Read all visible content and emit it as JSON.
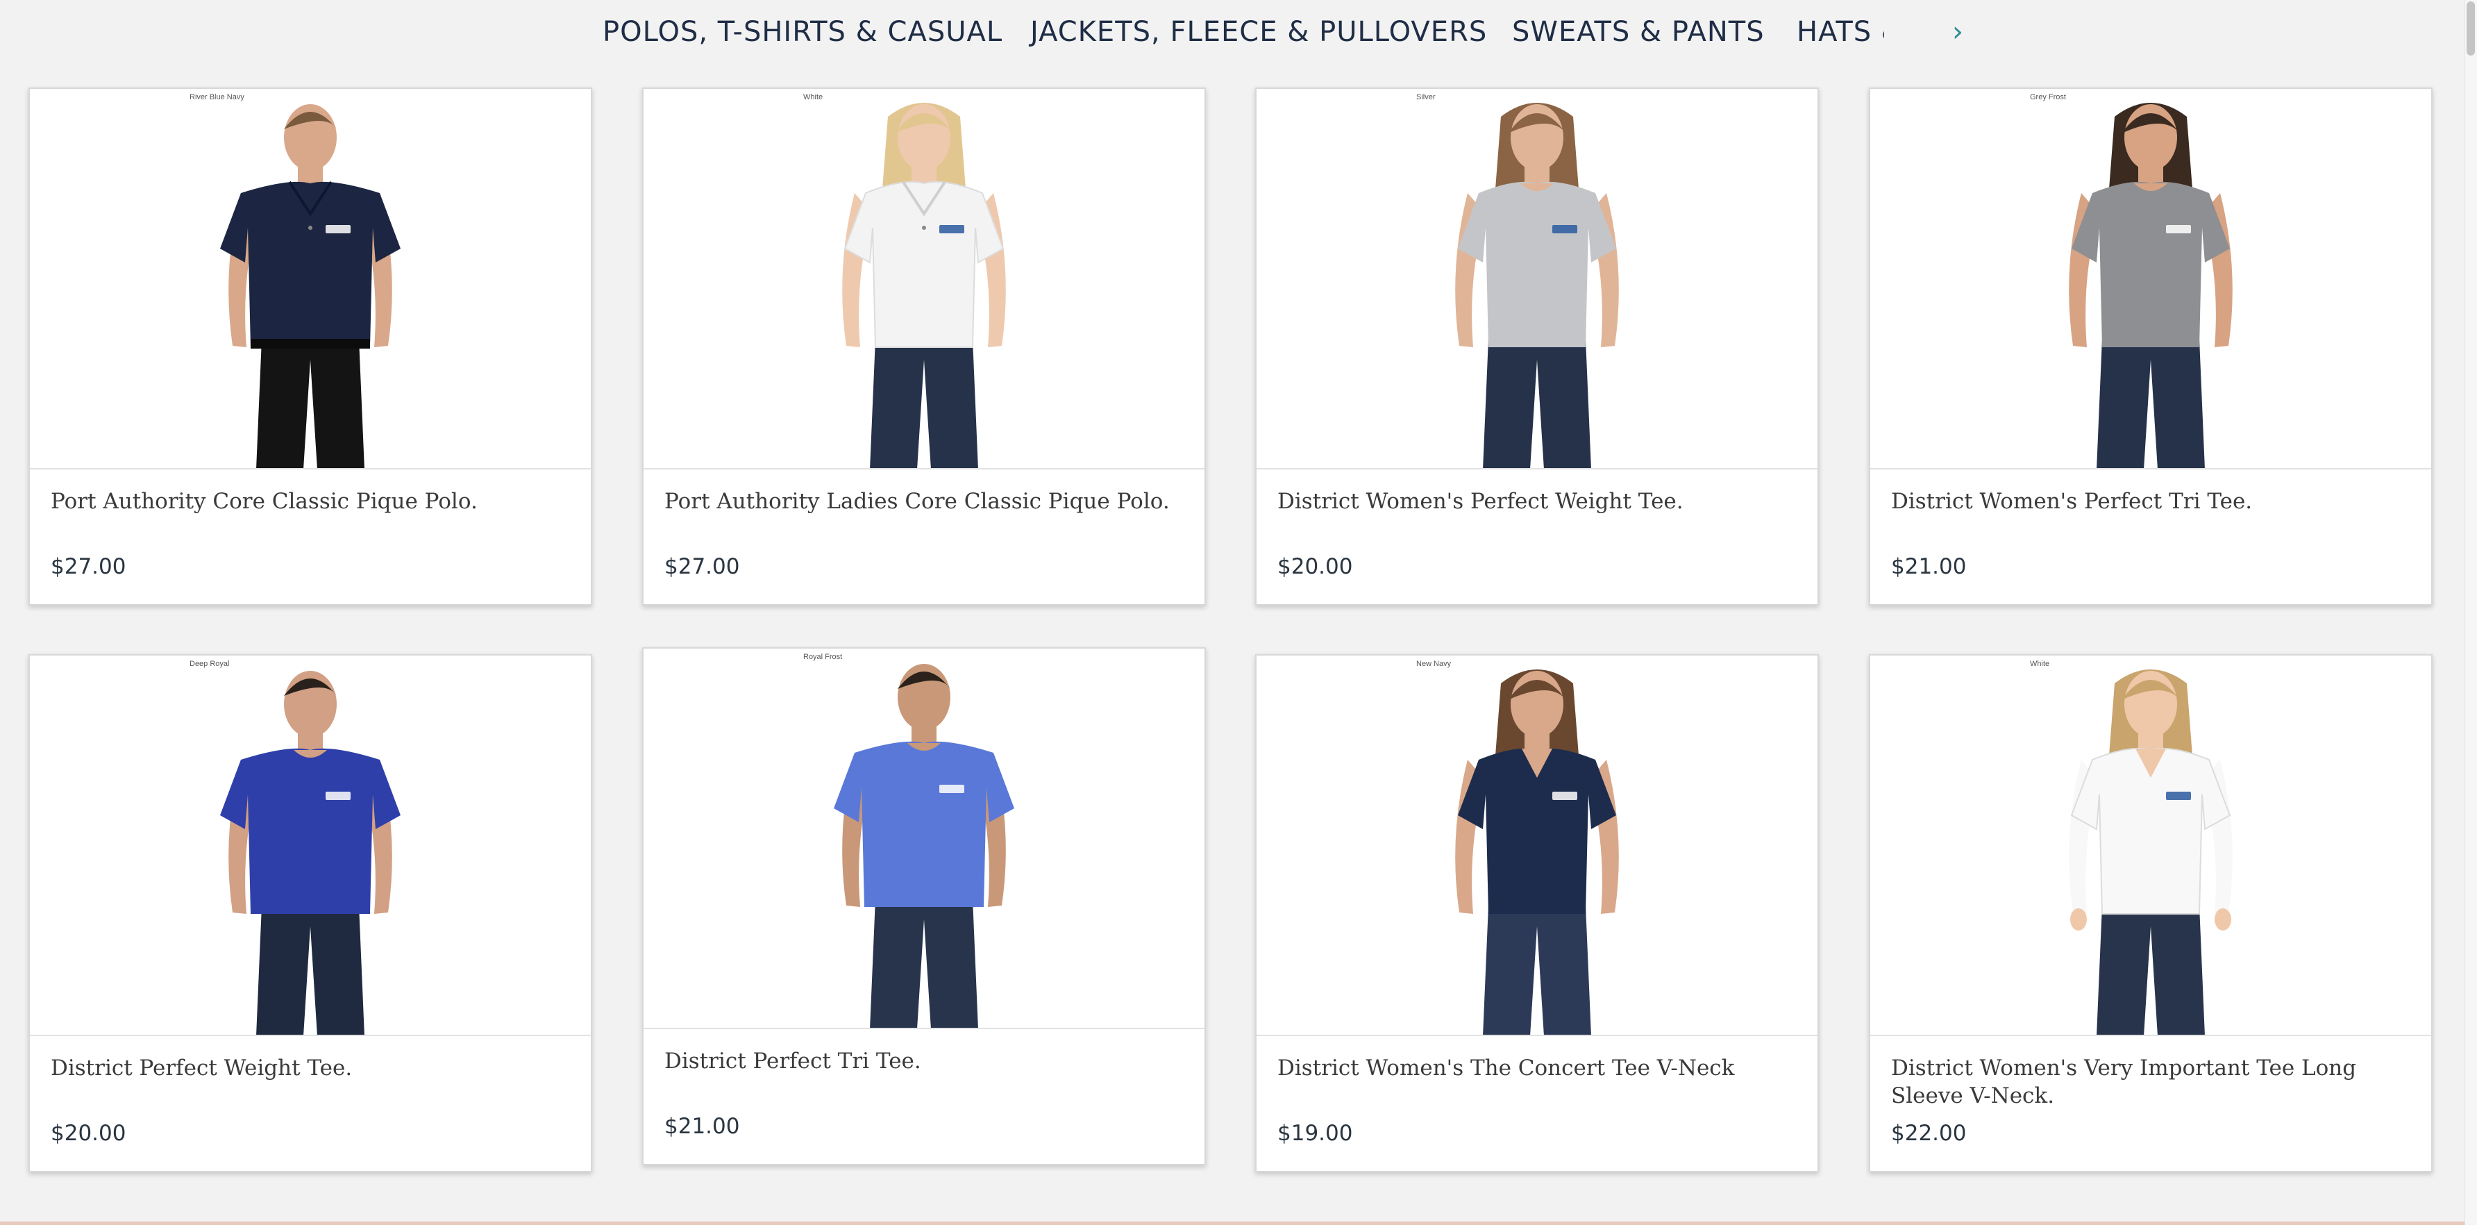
{
  "nav": {
    "items": [
      "POLOS, T-SHIRTS & CASUAL",
      "JACKETS, FLEECE & PULLOVERS",
      "SWEATS & PANTS",
      "HATS &"
    ],
    "next_arrow": "›"
  },
  "products": [
    {
      "color": "River Blue Navy",
      "title": "Port Authority Core Classic Pique Polo.",
      "price": "$27.00",
      "shirt_color": "#1c2642",
      "skin": "#d9a88a",
      "hair": "#7a5a3c",
      "pants": "#141414",
      "style": "polo-man"
    },
    {
      "color": "White",
      "title": "Port Authority Ladies Core Classic Pique Polo.",
      "price": "$27.00",
      "shirt_color": "#f3f3f3",
      "skin": "#efc9ae",
      "hair": "#e2c690",
      "pants": "#25324a",
      "style": "polo-woman"
    },
    {
      "color": "Silver",
      "title": "District Women's Perfect Weight Tee.",
      "price": "$20.00",
      "shirt_color": "#c4c5c8",
      "skin": "#e0b496",
      "hair": "#8a6444",
      "pants": "#25324a",
      "style": "tee-woman"
    },
    {
      "color": "Grey Frost",
      "title": "District Women's Perfect Tri Tee.",
      "price": "$21.00",
      "shirt_color": "#8e8f92",
      "skin": "#d7a383",
      "hair": "#3b2a20",
      "pants": "#25324a",
      "style": "tee-woman"
    },
    {
      "color": "Deep Royal",
      "title": "District Perfect Weight Tee.",
      "price": "$20.00",
      "shirt_color": "#2f3faa",
      "skin": "#d2a084",
      "hair": "#2a211c",
      "pants": "#1f2a40",
      "style": "tee-man"
    },
    {
      "color": "Royal Frost",
      "title": "District Perfect Tri Tee.",
      "price": "$21.00",
      "shirt_color": "#5a78d8",
      "skin": "#c89878",
      "hair": "#2b221c",
      "pants": "#27344c",
      "style": "tee-man"
    },
    {
      "color": "New Navy",
      "title": "District Women's The Concert Tee V-Neck",
      "price": "$19.00",
      "shirt_color": "#1d2c4c",
      "skin": "#d9a88a",
      "hair": "#6a4830",
      "pants": "#2c3a58",
      "style": "vneck-woman"
    },
    {
      "color": "White",
      "title": "District Women's Very Important Tee Long Sleeve V-Neck.",
      "price": "$22.00",
      "shirt_color": "#f8f8f8",
      "skin": "#efc8aa",
      "hair": "#c9a46c",
      "pants": "#27344c",
      "style": "longsleeve-woman"
    }
  ]
}
